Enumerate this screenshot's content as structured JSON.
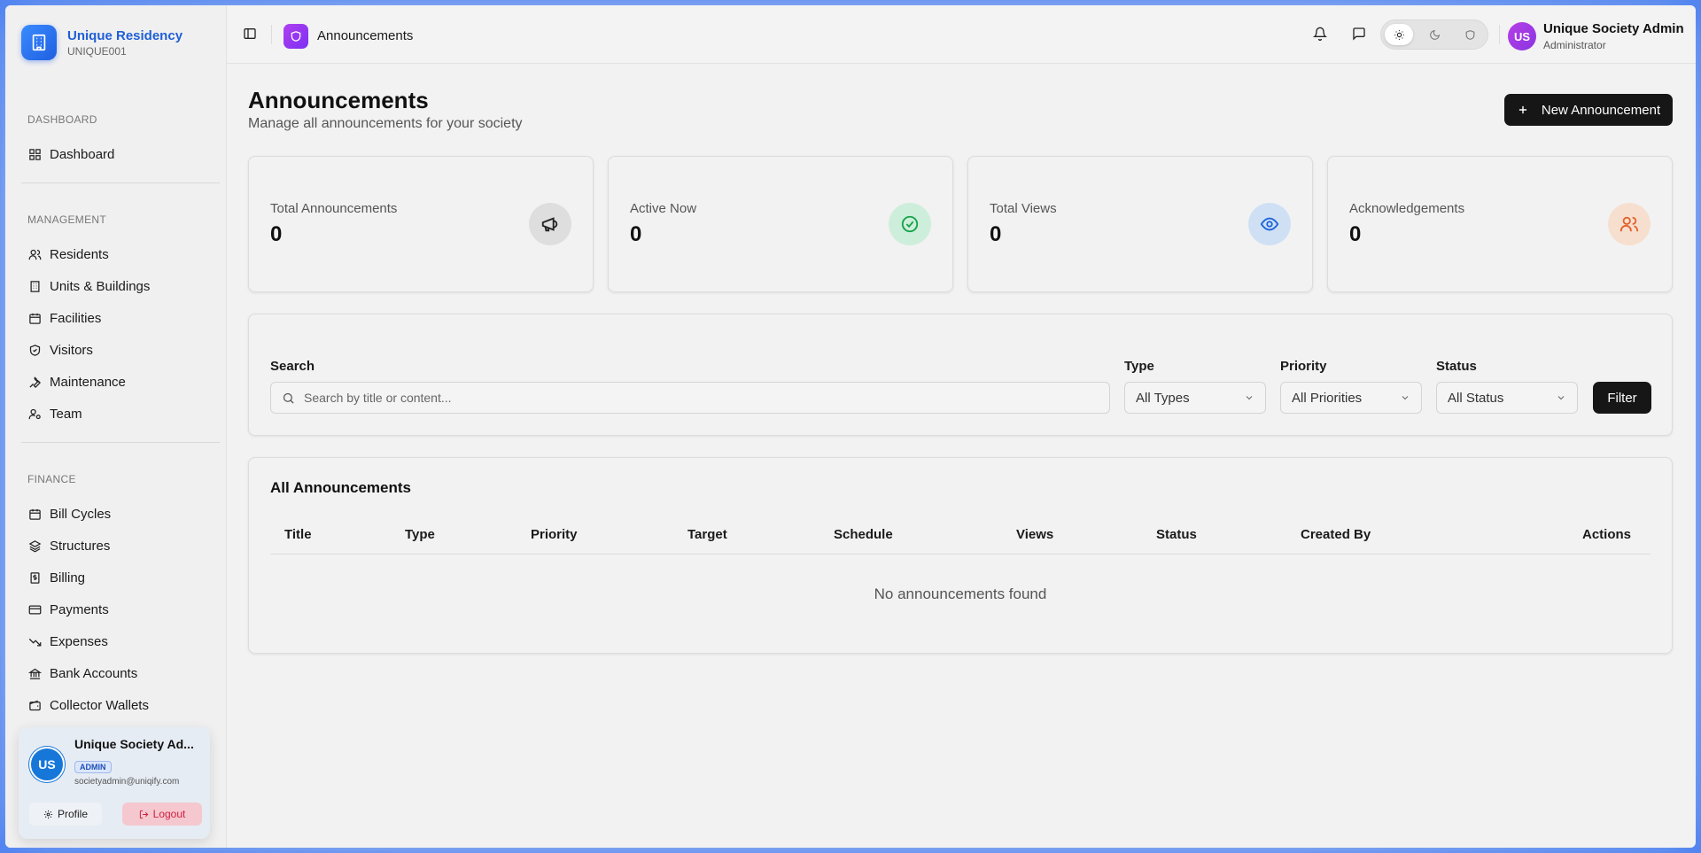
{
  "brand": {
    "name": "Unique Residency",
    "code": "UNIQUE001"
  },
  "sidebar": {
    "sections": [
      {
        "title": "DASHBOARD",
        "items": [
          {
            "label": "Dashboard",
            "icon": "grid-icon"
          }
        ]
      },
      {
        "title": "MANAGEMENT",
        "items": [
          {
            "label": "Residents",
            "icon": "users-icon"
          },
          {
            "label": "Units & Buildings",
            "icon": "building-icon"
          },
          {
            "label": "Facilities",
            "icon": "calendar-icon"
          },
          {
            "label": "Visitors",
            "icon": "shield-icon"
          },
          {
            "label": "Maintenance",
            "icon": "wrench-icon"
          },
          {
            "label": "Team",
            "icon": "user-cog-icon"
          }
        ]
      },
      {
        "title": "FINANCE",
        "items": [
          {
            "label": "Bill Cycles",
            "icon": "calendar-icon"
          },
          {
            "label": "Structures",
            "icon": "layers-icon"
          },
          {
            "label": "Billing",
            "icon": "receipt-icon"
          },
          {
            "label": "Payments",
            "icon": "credit-card-icon"
          },
          {
            "label": "Expenses",
            "icon": "trending-down-icon"
          },
          {
            "label": "Bank Accounts",
            "icon": "bank-icon"
          },
          {
            "label": "Collector Wallets",
            "icon": "wallet-icon"
          }
        ]
      }
    ]
  },
  "user_card": {
    "initials": "US",
    "name": "Unique Society Ad...",
    "badge": "ADMIN",
    "email": "societyadmin@uniqify.com",
    "profile_label": "Profile",
    "logout_label": "Logout"
  },
  "header": {
    "page_title": "Announcements",
    "user_initials": "US",
    "user_name": "Unique Society Admin",
    "user_role": "Administrator"
  },
  "page": {
    "title": "Announcements",
    "subtitle": "Manage all announcements for your society",
    "new_button": "New Announcement"
  },
  "stats": [
    {
      "label": "Total Announcements",
      "value": "0",
      "icon": "megaphone-icon",
      "bg": "#dedede",
      "fg": "#222222"
    },
    {
      "label": "Active Now",
      "value": "0",
      "icon": "check-circle-icon",
      "bg": "#cdeedb",
      "fg": "#17a34a"
    },
    {
      "label": "Total Views",
      "value": "0",
      "icon": "eye-icon",
      "bg": "#cfe0f5",
      "fg": "#1d64d8"
    },
    {
      "label": "Acknowledgements",
      "value": "0",
      "icon": "users-icon",
      "bg": "#f7dfcf",
      "fg": "#e2622a"
    }
  ],
  "filters": {
    "search_label": "Search",
    "search_placeholder": "Search by title or content...",
    "type_label": "Type",
    "type_value": "All Types",
    "priority_label": "Priority",
    "priority_value": "All Priorities",
    "status_label": "Status",
    "status_value": "All Status",
    "filter_button": "Filter"
  },
  "table": {
    "title": "All Announcements",
    "columns": [
      "Title",
      "Type",
      "Priority",
      "Target",
      "Schedule",
      "Views",
      "Status",
      "Created By",
      "Actions"
    ],
    "empty_text": "No announcements found"
  }
}
